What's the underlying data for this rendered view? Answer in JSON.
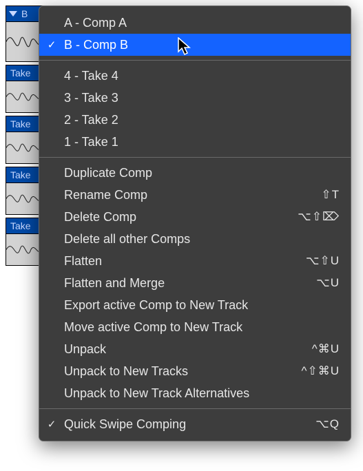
{
  "track_header": {
    "label": "B"
  },
  "takes": [
    {
      "label": "Take"
    },
    {
      "label": "Take"
    },
    {
      "label": "Take"
    },
    {
      "label": "Take"
    }
  ],
  "menu": {
    "comps": [
      {
        "label": "A - Comp A",
        "checked": false
      },
      {
        "label": "B - Comp B",
        "checked": true
      }
    ],
    "takes": [
      {
        "label": "4 - Take 4"
      },
      {
        "label": "3 - Take 3"
      },
      {
        "label": "2 - Take 2"
      },
      {
        "label": "1 - Take 1"
      }
    ],
    "actions": [
      {
        "label": "Duplicate Comp",
        "shortcut": ""
      },
      {
        "label": "Rename Comp",
        "shortcut": "⇧T"
      },
      {
        "label": "Delete Comp",
        "shortcut": "⌥⇧⌦"
      },
      {
        "label": "Delete all other Comps",
        "shortcut": ""
      },
      {
        "label": "Flatten",
        "shortcut": "⌥⇧U"
      },
      {
        "label": "Flatten and Merge",
        "shortcut": "⌥U"
      },
      {
        "label": "Export active Comp to New Track",
        "shortcut": ""
      },
      {
        "label": "Move active Comp to New Track",
        "shortcut": ""
      },
      {
        "label": "Unpack",
        "shortcut": "^⌘U"
      },
      {
        "label": "Unpack to New Tracks",
        "shortcut": "^⇧⌘U"
      },
      {
        "label": "Unpack to New Track Alternatives",
        "shortcut": ""
      }
    ],
    "footer": {
      "label": "Quick Swipe Comping",
      "shortcut": "⌥Q",
      "checked": true
    }
  }
}
